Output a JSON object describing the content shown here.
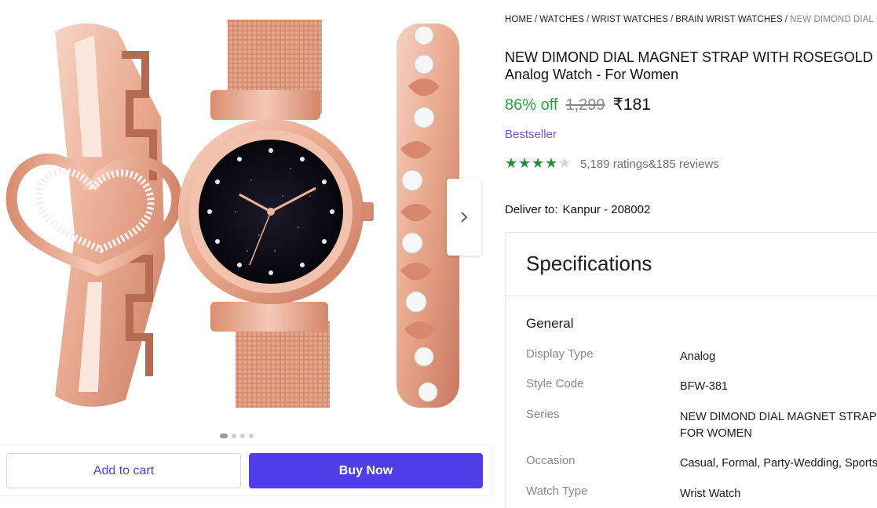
{
  "colors": {
    "discount_green": "#26a541",
    "star_green": "#1f8f3a",
    "badge_purple": "#7b4ed8",
    "buy_button": "#4f3ee8",
    "cart_text": "#4d43c7"
  },
  "gallery": {
    "image_count": 4,
    "active_index": 0,
    "next_icon": "chevron-right-icon"
  },
  "actions": {
    "add_to_cart": "Add to cart",
    "buy_now": "Buy Now"
  },
  "breadcrumb": [
    "HOME",
    "WATCHES",
    "WRIST WATCHES",
    "BRAIN WRIST WATCHES",
    "NEW DIMOND DIAL MA"
  ],
  "product": {
    "title": "NEW DIMOND DIAL MAGNET STRAP WITH ROSEGOLD TWO Analog Watch  - For Women",
    "discount": "86% off",
    "mrp": "1,299",
    "price": "₹181",
    "badge": "Bestseller",
    "rating": 4,
    "rating_max": 5,
    "ratings_count": "5,189 ratings",
    "reviews_count": "185 reviews",
    "reviews_joiner": "&"
  },
  "delivery": {
    "label": "Deliver to:",
    "location": "Kanpur - 208002"
  },
  "specifications": {
    "heading": "Specifications",
    "group": "General",
    "rows": [
      {
        "label": "Display Type",
        "value": "Analog"
      },
      {
        "label": "Style Code",
        "value": "BFW-381"
      },
      {
        "label": "Series",
        "value": "NEW DIMOND DIAL MAGNET STRAP FOR WOMEN"
      },
      {
        "label": "Occasion",
        "value": "Casual, Formal, Party-Wedding, Sports"
      },
      {
        "label": "Watch Type",
        "value": "Wrist Watch"
      }
    ]
  }
}
